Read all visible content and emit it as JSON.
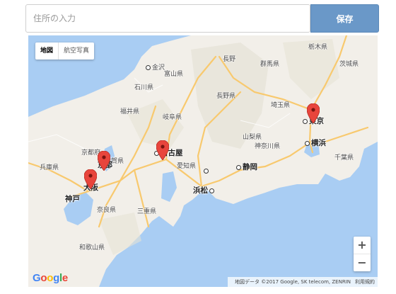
{
  "toolbar": {
    "address_placeholder": "住所の入力",
    "address_value": "",
    "save_label": "保存"
  },
  "map": {
    "type_controls": {
      "map": "地図",
      "satellite": "航空写真"
    },
    "zoom": {
      "in": "+",
      "out": "−"
    },
    "attribution": "地図データ ©2017 Google, SK telecom, ZENRIN",
    "terms": "利用規約",
    "logo": [
      "G",
      "o",
      "o",
      "g",
      "l",
      "e"
    ],
    "prefectures": [
      "金沢",
      "富山県",
      "長野",
      "群馬県",
      "栃木県",
      "茨城県",
      "石川県",
      "長野県",
      "福井県",
      "岐阜県",
      "埼玉県",
      "山梨県",
      "神奈川県",
      "千葉県",
      "京都府",
      "兵庫県",
      "滋賀県",
      "愛知県",
      "奈良県",
      "三重県",
      "和歌山県"
    ],
    "cities": [
      "東京",
      "横浜",
      "名古屋",
      "静岡",
      "浜松",
      "京都",
      "大阪",
      "神戸"
    ],
    "markers": [
      "東京",
      "名古屋",
      "京都",
      "大阪"
    ],
    "colors": {
      "water": "#a9cdf3",
      "land": "#f2efe9",
      "highway": "#f8c96e",
      "marker": "#e8453c"
    }
  }
}
